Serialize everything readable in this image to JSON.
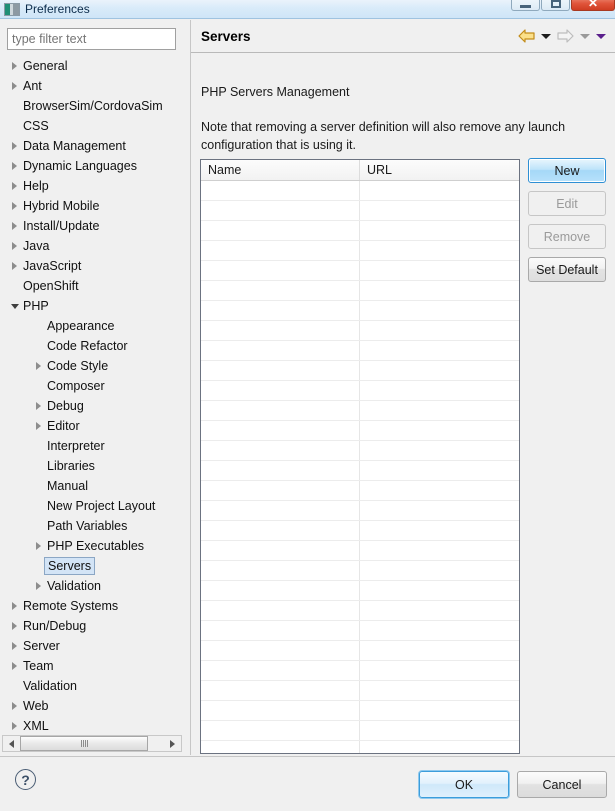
{
  "window": {
    "title": "Preferences",
    "icon": "eclipse-icon",
    "controls": {
      "minimize": "minimize-icon",
      "maximize": "maximize-icon",
      "close": "✕"
    }
  },
  "filter": {
    "placeholder": "type filter text",
    "value": ""
  },
  "tree": {
    "items": [
      {
        "label": "General",
        "depth": 0,
        "arrow": "collapsed",
        "selected": false
      },
      {
        "label": "Ant",
        "depth": 0,
        "arrow": "collapsed",
        "selected": false
      },
      {
        "label": "BrowserSim/CordovaSim",
        "depth": 0,
        "arrow": "none",
        "selected": false
      },
      {
        "label": "CSS",
        "depth": 0,
        "arrow": "none",
        "selected": false
      },
      {
        "label": "Data Management",
        "depth": 0,
        "arrow": "collapsed",
        "selected": false
      },
      {
        "label": "Dynamic Languages",
        "depth": 0,
        "arrow": "collapsed",
        "selected": false
      },
      {
        "label": "Help",
        "depth": 0,
        "arrow": "collapsed",
        "selected": false
      },
      {
        "label": "Hybrid Mobile",
        "depth": 0,
        "arrow": "collapsed",
        "selected": false
      },
      {
        "label": "Install/Update",
        "depth": 0,
        "arrow": "collapsed",
        "selected": false
      },
      {
        "label": "Java",
        "depth": 0,
        "arrow": "collapsed",
        "selected": false
      },
      {
        "label": "JavaScript",
        "depth": 0,
        "arrow": "collapsed",
        "selected": false
      },
      {
        "label": "OpenShift",
        "depth": 0,
        "arrow": "none",
        "selected": false
      },
      {
        "label": "PHP",
        "depth": 0,
        "arrow": "expanded",
        "selected": false
      },
      {
        "label": "Appearance",
        "depth": 1,
        "arrow": "none",
        "selected": false
      },
      {
        "label": "Code Refactor",
        "depth": 1,
        "arrow": "none",
        "selected": false
      },
      {
        "label": "Code Style",
        "depth": 1,
        "arrow": "collapsed",
        "selected": false
      },
      {
        "label": "Composer",
        "depth": 1,
        "arrow": "none",
        "selected": false
      },
      {
        "label": "Debug",
        "depth": 1,
        "arrow": "collapsed",
        "selected": false
      },
      {
        "label": "Editor",
        "depth": 1,
        "arrow": "collapsed",
        "selected": false
      },
      {
        "label": "Interpreter",
        "depth": 1,
        "arrow": "none",
        "selected": false
      },
      {
        "label": "Libraries",
        "depth": 1,
        "arrow": "none",
        "selected": false
      },
      {
        "label": "Manual",
        "depth": 1,
        "arrow": "none",
        "selected": false
      },
      {
        "label": "New Project Layout",
        "depth": 1,
        "arrow": "none",
        "selected": false
      },
      {
        "label": "Path Variables",
        "depth": 1,
        "arrow": "none",
        "selected": false
      },
      {
        "label": "PHP Executables",
        "depth": 1,
        "arrow": "collapsed",
        "selected": false
      },
      {
        "label": "Servers",
        "depth": 1,
        "arrow": "none",
        "selected": true
      },
      {
        "label": "Validation",
        "depth": 1,
        "arrow": "collapsed",
        "selected": false
      },
      {
        "label": "Remote Systems",
        "depth": 0,
        "arrow": "collapsed",
        "selected": false
      },
      {
        "label": "Run/Debug",
        "depth": 0,
        "arrow": "collapsed",
        "selected": false
      },
      {
        "label": "Server",
        "depth": 0,
        "arrow": "collapsed",
        "selected": false
      },
      {
        "label": "Team",
        "depth": 0,
        "arrow": "collapsed",
        "selected": false
      },
      {
        "label": "Validation",
        "depth": 0,
        "arrow": "none",
        "selected": false
      },
      {
        "label": "Web",
        "depth": 0,
        "arrow": "collapsed",
        "selected": false
      },
      {
        "label": "XML",
        "depth": 0,
        "arrow": "collapsed",
        "selected": false
      }
    ],
    "scrollbar": {
      "left_arrow": "scroll-left-icon",
      "right_arrow": "scroll-right-icon",
      "thumb": "scroll-thumb"
    }
  },
  "panel": {
    "title": "Servers",
    "nav": {
      "back_icon": "back-arrow-icon",
      "back_enabled": true,
      "back_color": "#f2c24a",
      "back_caret_color": "#1c1c1c",
      "forward_icon": "forward-arrow-icon",
      "forward_enabled": false,
      "forward_color": "#c9c9c9",
      "forward_caret_color": "#9a9a9a",
      "menu_caret_color": "#5a1f8c"
    },
    "heading": "PHP Servers Management",
    "note": "Note that removing a server definition will also remove any launch configuration that is using it.",
    "table": {
      "columns": [
        "Name",
        "URL"
      ],
      "rows": [],
      "empty_row_count": 29
    },
    "buttons": [
      {
        "label": "New",
        "state": "default"
      },
      {
        "label": "Edit",
        "state": "disabled"
      },
      {
        "label": "Remove",
        "state": "disabled"
      },
      {
        "label": "Set Default",
        "state": "enabled"
      }
    ]
  },
  "footer": {
    "help_icon": "help-icon",
    "help_glyph": "?",
    "ok_label": "OK",
    "cancel_label": "Cancel"
  }
}
